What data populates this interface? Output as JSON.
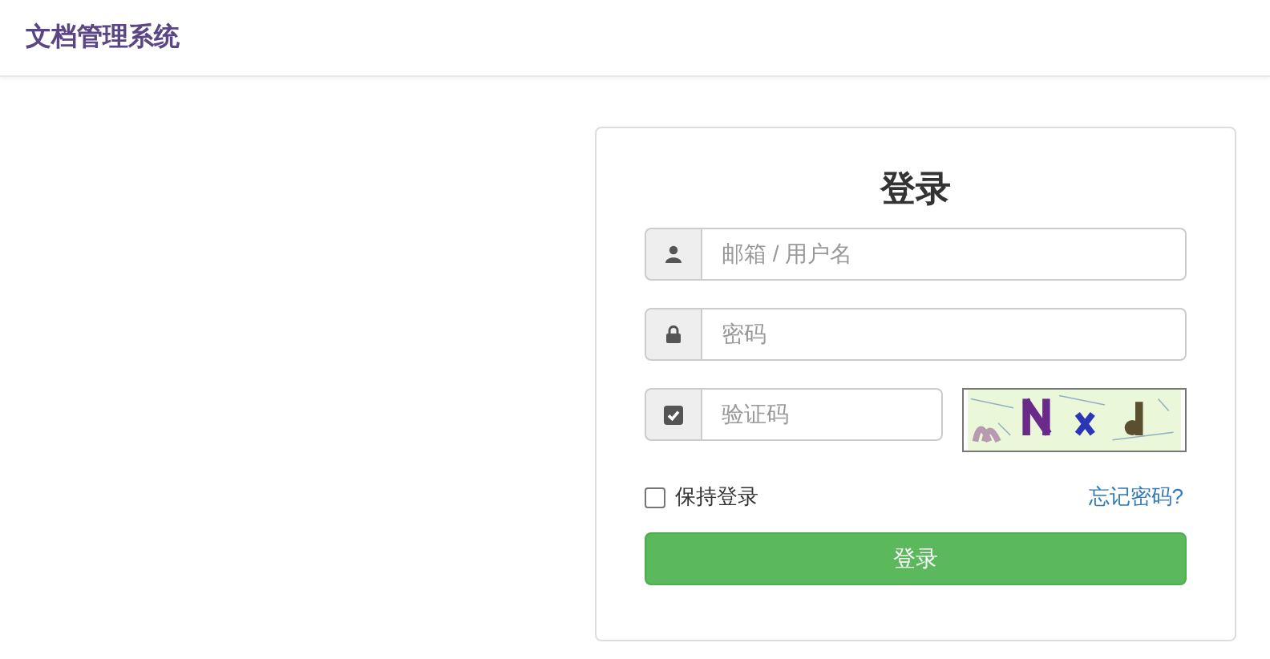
{
  "header": {
    "title": "文档管理系统"
  },
  "login": {
    "title": "登录",
    "fields": [
      {
        "kind": "user",
        "placeholder": "邮箱 / 用户名"
      },
      {
        "kind": "lock",
        "placeholder": "密码"
      },
      {
        "kind": "captcha",
        "placeholder": "验证码"
      }
    ],
    "remember": {
      "label": "保持登录",
      "checked": false
    },
    "forgot_link": "忘记密码?",
    "submit": "登录"
  }
}
